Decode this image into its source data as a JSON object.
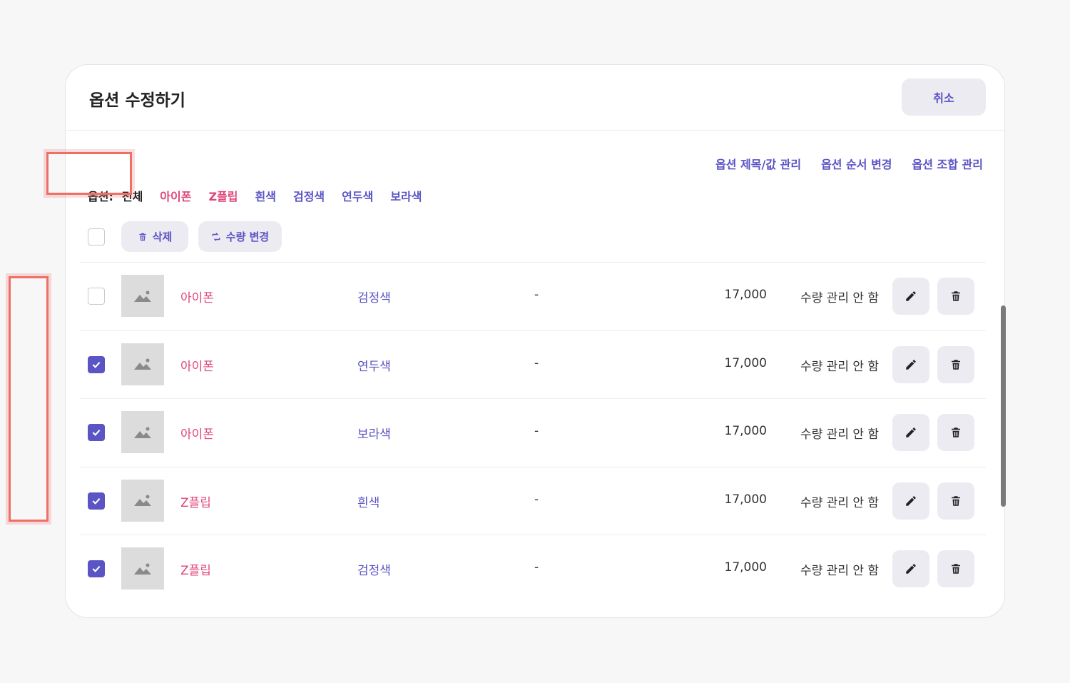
{
  "modal": {
    "title": "옵션 수정하기",
    "cancel_label": "취소"
  },
  "management_links": [
    "옵션 제목/값 관리",
    "옵션 순서 변경",
    "옵션 조합 관리"
  ],
  "filter": {
    "label": "옵션:",
    "items": [
      {
        "label": "전체",
        "color": "#222222"
      },
      {
        "label": "아이폰",
        "color": "#e0457b"
      },
      {
        "label": "Z플립",
        "color": "#e0457b"
      },
      {
        "label": "흰색",
        "color": "#5b54c4"
      },
      {
        "label": "검정색",
        "color": "#5b54c4"
      },
      {
        "label": "연두색",
        "color": "#5b54c4"
      },
      {
        "label": "보라색",
        "color": "#5b54c4"
      }
    ]
  },
  "toolbar": {
    "delete_label": "삭제",
    "delete_icon": "trash-icon",
    "qty_label": "수량 변경",
    "qty_icon": "refresh-icon"
  },
  "colors": {
    "accent": "#5b54c4",
    "product": "#e0457b",
    "highlight": "#ef6f68"
  },
  "rows": [
    {
      "checked": false,
      "product": "아이폰",
      "color": "검정색",
      "extra": "-",
      "price": "17,000",
      "stock": "수량 관리 안 함"
    },
    {
      "checked": true,
      "product": "아이폰",
      "color": "연두색",
      "extra": "-",
      "price": "17,000",
      "stock": "수량 관리 안 함"
    },
    {
      "checked": true,
      "product": "아이폰",
      "color": "보라색",
      "extra": "-",
      "price": "17,000",
      "stock": "수량 관리 안 함"
    },
    {
      "checked": true,
      "product": "Z플립",
      "color": "흰색",
      "extra": "-",
      "price": "17,000",
      "stock": "수량 관리 안 함"
    },
    {
      "checked": true,
      "product": "Z플립",
      "color": "검정색",
      "extra": "-",
      "price": "17,000",
      "stock": "수량 관리 안 함"
    }
  ]
}
